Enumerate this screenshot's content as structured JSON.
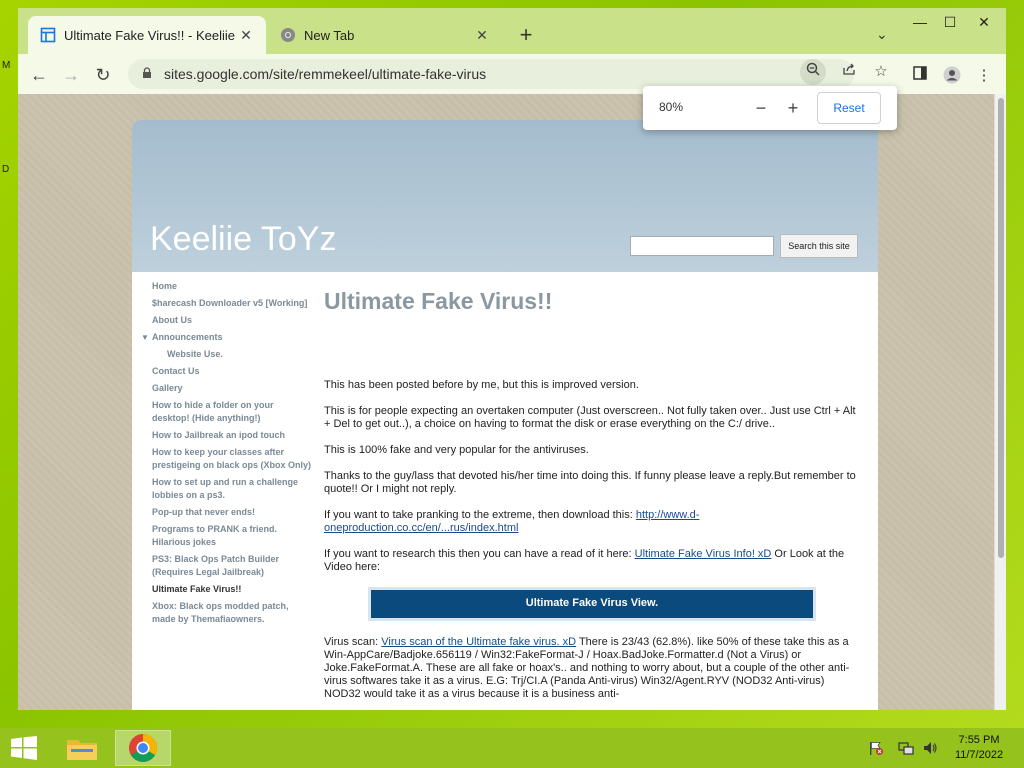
{
  "desktop": {
    "edge_letters": [
      "M",
      "D"
    ]
  },
  "tabs": [
    {
      "title": "Ultimate Fake Virus!! - Keeliie ToYz",
      "active": true
    },
    {
      "title": "New Tab",
      "active": false
    }
  ],
  "window_controls": {
    "minimize": "—",
    "maximize": "☐",
    "close": "✕"
  },
  "toolbar": {
    "back": "←",
    "forward": "→",
    "reload": "↻",
    "url": "sites.google.com/site/remmekeel/ultimate-fake-virus"
  },
  "zoom": {
    "value": "80%",
    "minus": "−",
    "plus": "+",
    "reset": "Reset"
  },
  "site": {
    "title": "Keeliie ToYz",
    "search_button": "Search this site",
    "sidebar": [
      {
        "label": "Home"
      },
      {
        "label": "$harecash Downloader v5 [Working]"
      },
      {
        "label": "About Us"
      },
      {
        "label": "Announcements",
        "expanded": true
      },
      {
        "label": "Website Use.",
        "sub": true
      },
      {
        "label": "Contact Us"
      },
      {
        "label": "Gallery"
      },
      {
        "label": "How to hide a folder on your desktop! (Hide anything!)"
      },
      {
        "label": "How to Jailbreak an ipod touch"
      },
      {
        "label": "How to keep your classes after prestigeing on black ops (Xbox Only)"
      },
      {
        "label": "How to set up and run a challenge lobbies on a ps3."
      },
      {
        "label": "Pop-up that never ends!"
      },
      {
        "label": "Programs to PRANK a friend. Hilarious jokes"
      },
      {
        "label": "PS3: Black Ops Patch Builder (Requires Legal Jailbreak)"
      },
      {
        "label": "Ultimate Fake Virus!!",
        "current": true
      },
      {
        "label": "Xbox: Black ops modded patch, made by Themafiaowners."
      }
    ],
    "page_title": "Ultimate Fake Virus!!",
    "paragraphs": {
      "p1": "This has been posted before by me, but this is improved version.",
      "p2": "This is for people expecting an overtaken computer (Just overscreen.. Not fully taken over.. Just use Ctrl + Alt + Del to get out..), a choice on having to format the disk or erase everything on the C:/ drive..",
      "p3": "This is 100% fake and very popular for the antiviruses.",
      "p4": "Thanks to the guy/lass that devoted his/her time into doing this. If funny please leave a reply.But remember to quote!! Or I might not reply.",
      "p5_text": "If you want to take pranking to the extreme, then download this: ",
      "p5_link": "http://www.d-oneproduction.co.cc/en/...rus/index.html",
      "p6_text": "If you want to research this then you can have a read of it here: ",
      "p6_link": "Ultimate Fake Virus Info! xD",
      "p6_tail": " Or Look at the Video here:",
      "video_label": "Ultimate Fake Virus View.",
      "p7_text": "Virus scan: ",
      "p7_link": "Virus scan of the Ultimate fake virus. xD",
      "p7_tail": " There is 23/43 (62.8%). like 50% of these take this as a Win-AppCare/Badjoke.656119 / Win32:FakeFormat-J / Hoax.BadJoke.Formatter.d (Not a Virus) or Joke.FakeFormat.A. These are all fake or hoax's.. and nothing to worry about, but a couple of the other anti-virus softwares take it as a virus. E.G: Trj/CI.A (Panda Anti-virus) Win32/Agent.RYV (NOD32 Anti-virus) NOD32 would take it as a virus because it is a business anti-"
    }
  },
  "taskbar": {
    "time": "7:55 PM",
    "date": "11/7/2022"
  }
}
